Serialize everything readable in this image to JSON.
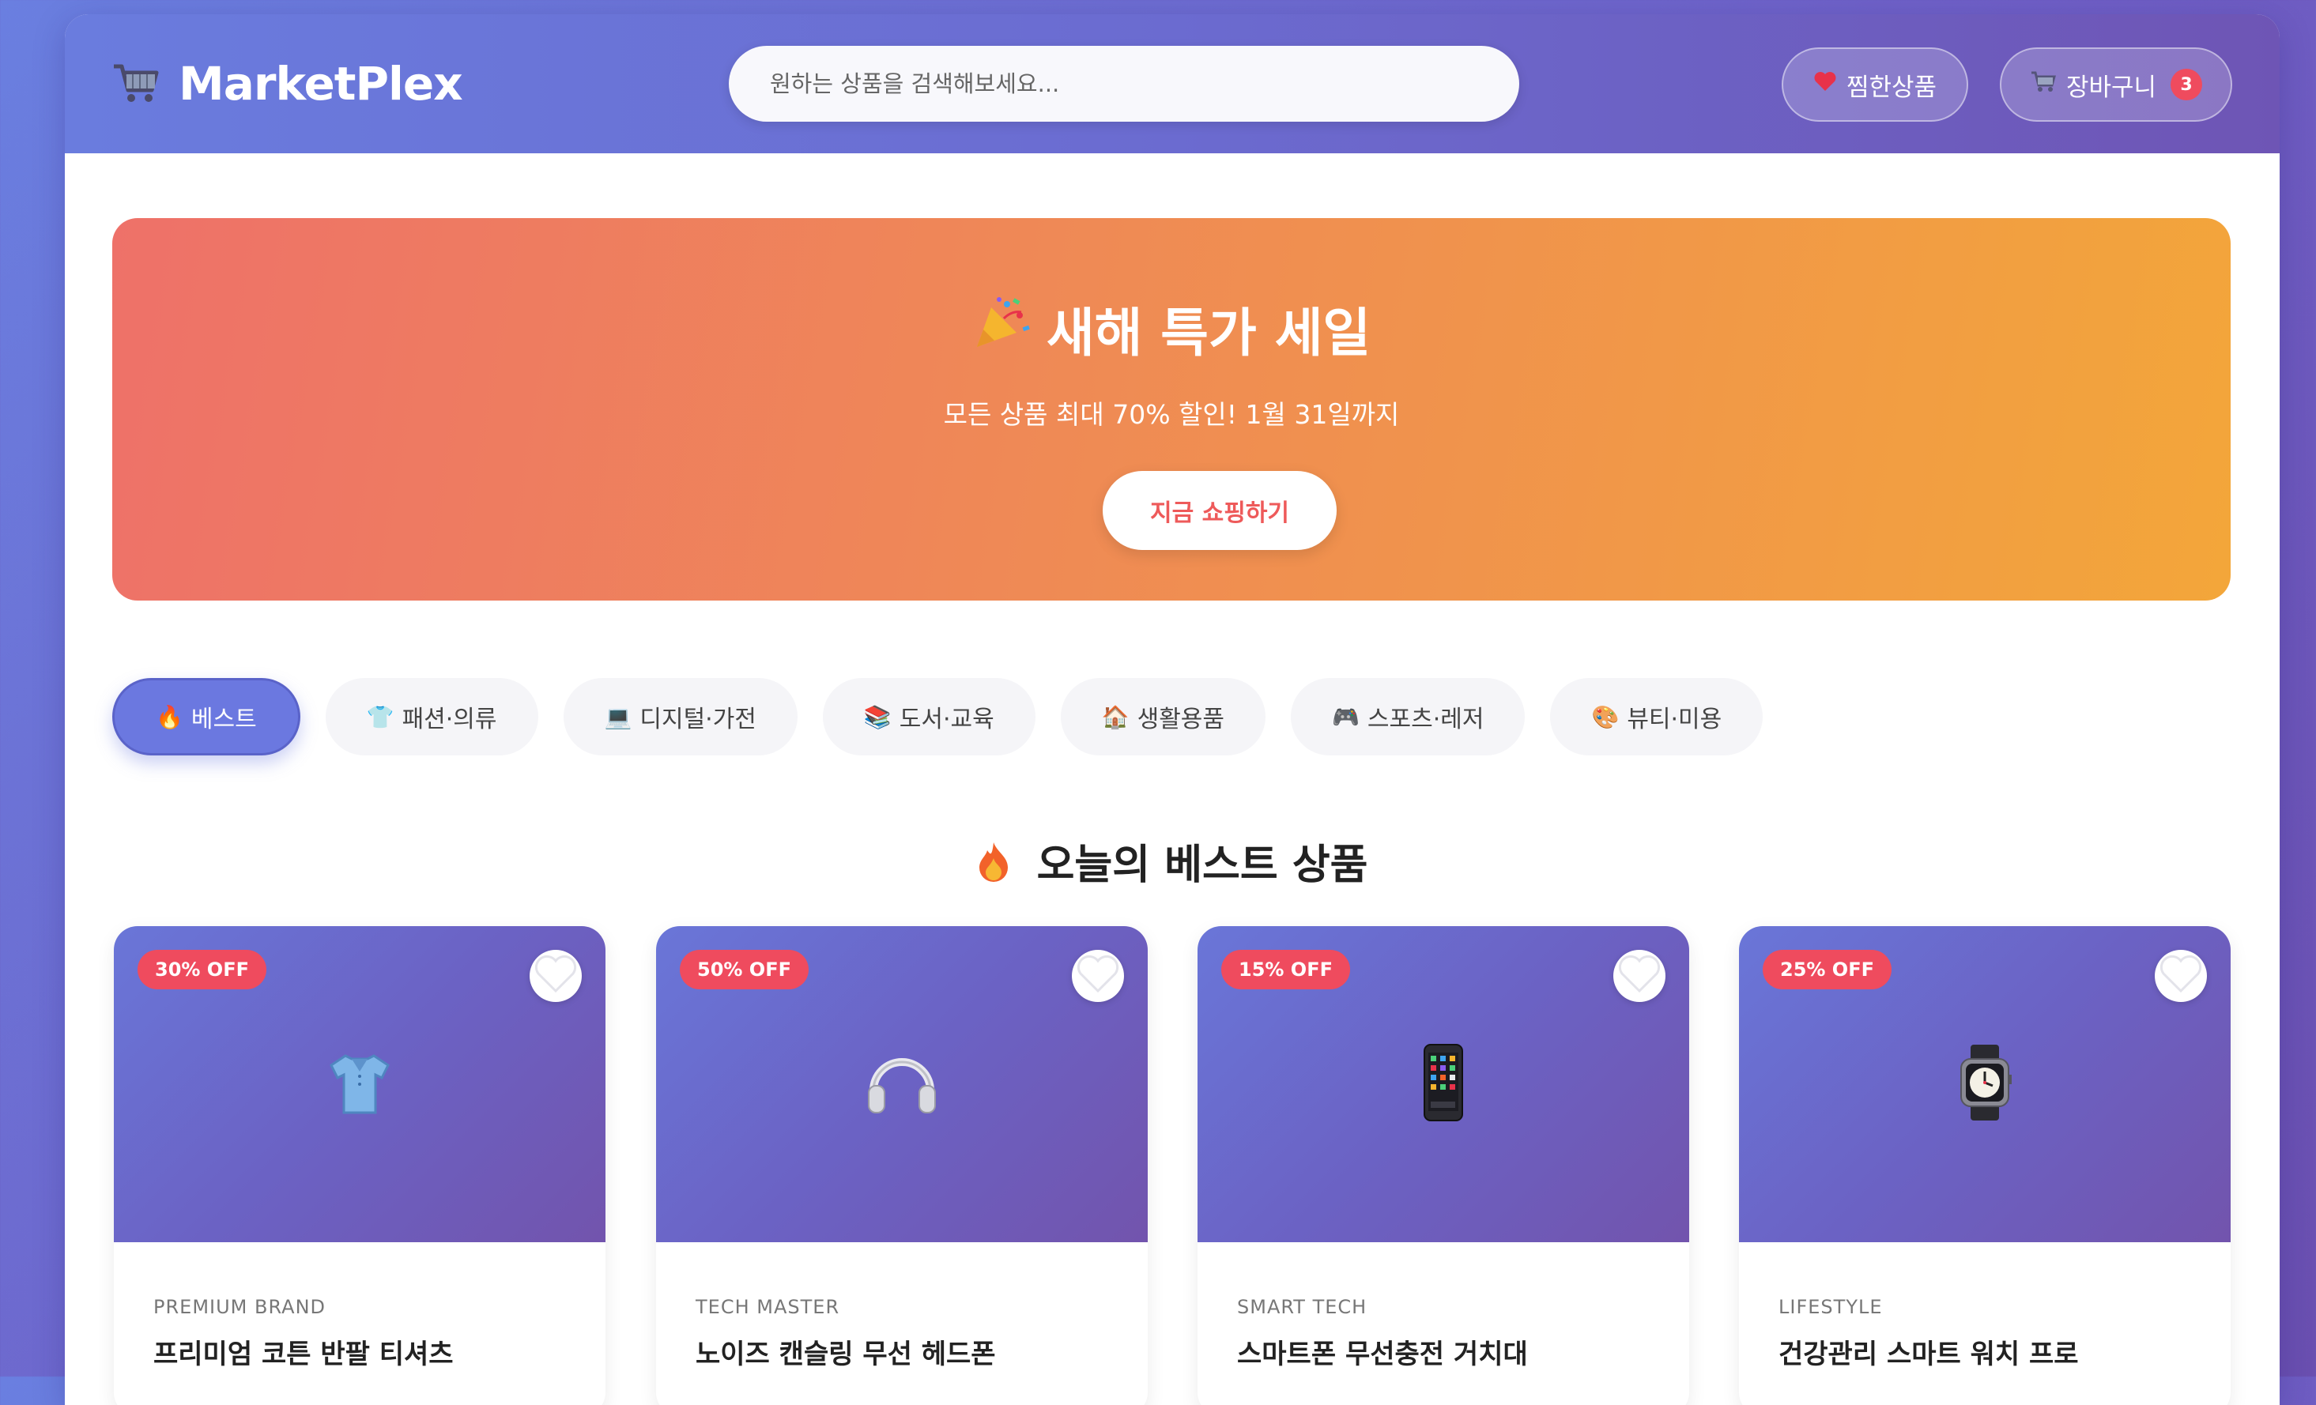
{
  "header": {
    "logo_text": "MarketPlex",
    "search_placeholder": "원하는 상품을 검색해보세요...",
    "wishlist_label": "찜한상품",
    "cart_label": "장바구니",
    "cart_count": "3"
  },
  "hero": {
    "title": "새해 특가 세일",
    "subtitle": "모든 상품 최대 70% 할인! 1월 31일까지",
    "cta_label": "지금 쇼핑하기"
  },
  "categories": [
    {
      "icon": "🔥",
      "label": "베스트",
      "active": true
    },
    {
      "icon": "👕",
      "label": "패션·의류"
    },
    {
      "icon": "💻",
      "label": "디지털·가전"
    },
    {
      "icon": "📚",
      "label": "도서·교육"
    },
    {
      "icon": "🏠",
      "label": "생활용품"
    },
    {
      "icon": "🎮",
      "label": "스포츠·레저"
    },
    {
      "icon": "🎨",
      "label": "뷰티·미용"
    }
  ],
  "section": {
    "title": "오늘의 베스트 상품"
  },
  "products": [
    {
      "discount": "30% OFF",
      "icon": "shirt-icon",
      "brand": "PREMIUM BRAND",
      "name": "프리미엄 코튼 반팔 티셔츠"
    },
    {
      "discount": "50% OFF",
      "icon": "headphones-icon",
      "brand": "TECH MASTER",
      "name": "노이즈 캔슬링 무선 헤드폰"
    },
    {
      "discount": "15% OFF",
      "icon": "phone-icon",
      "brand": "SMART TECH",
      "name": "스마트폰 무선충전 거치대"
    },
    {
      "discount": "25% OFF",
      "icon": "watch-icon",
      "brand": "LIFESTYLE",
      "name": "건강관리 스마트 워치 프로"
    }
  ],
  "colors": {
    "accent": "#6b78e0",
    "badge": "#ef4b5e",
    "hero_start": "#ee7169",
    "hero_end": "#f3a63a"
  }
}
